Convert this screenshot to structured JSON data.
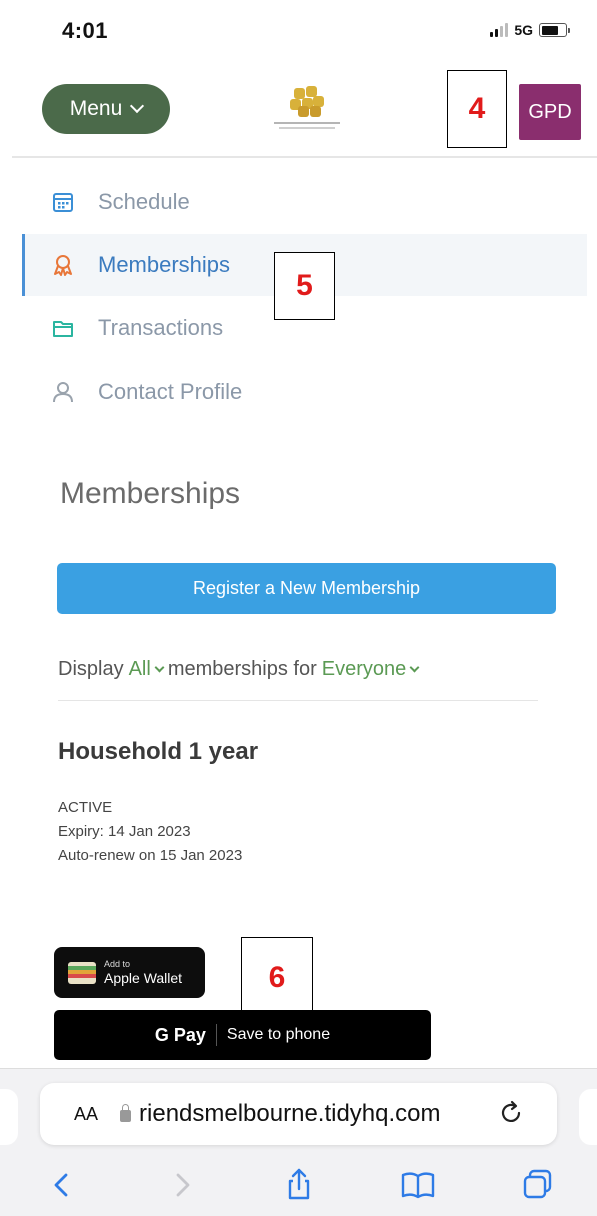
{
  "status_bar": {
    "time": "4:01",
    "network": "5G"
  },
  "header": {
    "menu_label": "Menu",
    "avatar_initials": "GPD",
    "accent_color": "#4b6a4a",
    "avatar_color": "#8a2e6e"
  },
  "nav": {
    "items": [
      {
        "label": "Schedule",
        "icon": "calendar-icon",
        "active": false
      },
      {
        "label": "Memberships",
        "icon": "award-icon",
        "active": true
      },
      {
        "label": "Transactions",
        "icon": "folder-icon",
        "active": false
      },
      {
        "label": "Contact Profile",
        "icon": "user-icon",
        "active": false
      }
    ]
  },
  "main": {
    "heading": "Memberships",
    "register_button": "Register a New Membership",
    "display_filter": {
      "prefix": "Display",
      "status_value": "All",
      "middle": "memberships for",
      "person_value": "Everyone"
    },
    "membership": {
      "title": "Household 1 year",
      "status": "ACTIVE",
      "expiry": "Expiry: 14 Jan 2023",
      "auto_renew": "Auto-renew on 15 Jan 2023"
    },
    "wallet": {
      "small_label": "Add to",
      "big_label": "Apple Wallet"
    },
    "gpay": {
      "brand": "G Pay",
      "label": "Save to phone"
    }
  },
  "annotations": {
    "callout_4": "4",
    "callout_5": "5",
    "callout_6": "6"
  },
  "browser": {
    "aa_label": "AA",
    "url": "riendsmelbourne.tidyhq.com"
  }
}
